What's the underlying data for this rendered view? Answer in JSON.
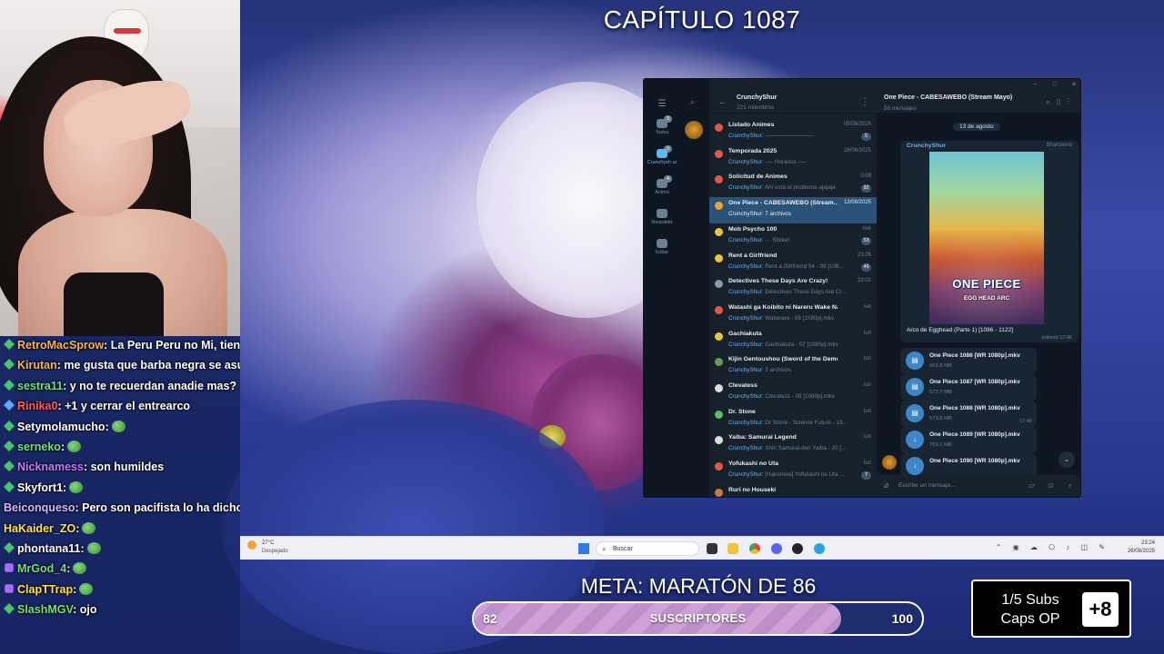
{
  "stream": {
    "title": "CAPÍTULO 1087",
    "goal_title": "META: MARATÓN DE 86",
    "goal": {
      "current": "82",
      "label": "SUSCRIPTORES",
      "max": "100",
      "progress_fraction": 0.82
    },
    "subs_box": {
      "line1": "1/5 Subs",
      "line2": "Caps OP",
      "plus": "+8"
    }
  },
  "chat": [
    {
      "badge": "diamond",
      "user": "RetroMacSprow",
      "color": "#ffb347",
      "msg": ": La Peru Peru no Mi, tiene"
    },
    {
      "badge": "diamond",
      "user": "Kirutan",
      "color": "#ffb347",
      "msg": ": me gusta que barba negra se asu"
    },
    {
      "badge": "diamond",
      "user": "sestra11",
      "color": "#6fe37a",
      "msg": ": y no te recuerdan anadie mas?"
    },
    {
      "badge": "blue",
      "user": "Rinika0",
      "color": "#ff5a5a",
      "msg": ": +1 y cerrar el entrearco"
    },
    {
      "badge": "diamond",
      "user": "Setymolamucho",
      "color": "#ffffff",
      "msg": ":",
      "emote": true
    },
    {
      "badge": "diamond",
      "user": "serneko",
      "color": "#6fe37a",
      "msg": ":",
      "emote": true
    },
    {
      "badge": "diamond",
      "user": "Nicknamess",
      "color": "#c778ff",
      "msg": ": son humildes"
    },
    {
      "badge": "diamond",
      "user": "Skyfort1",
      "color": "#ffffff",
      "msg": ":",
      "emote": true
    },
    {
      "badge": "",
      "user": "Beiconqueso",
      "color": "#d7b6ff",
      "msg": ": Pero son pacifista lo ha dicho"
    },
    {
      "badge": "",
      "user": "HaKaider_ZO",
      "color": "#ffe14a",
      "msg": ":",
      "emote": true
    },
    {
      "badge": "diamond",
      "user": "phontana11",
      "color": "#ffffff",
      "msg": ":",
      "emote": true
    },
    {
      "badge": "purple",
      "user": "MrGod_4",
      "color": "#6fe37a",
      "msg": ":",
      "emote": true
    },
    {
      "badge": "purple",
      "user": "ClapTTrap",
      "color": "#ffe14a",
      "msg": ":",
      "emote": true
    },
    {
      "badge": "diamond",
      "user": "SlashMGV",
      "color": "#6fe37a",
      "msg": ": ojo"
    }
  ],
  "telegram": {
    "group_name": "CrunchyShur",
    "group_members": "221 miembros",
    "rail": [
      {
        "label": "Todos",
        "count": "3"
      },
      {
        "label": "Crunchysh ur",
        "count": "3"
      },
      {
        "label": "Animú",
        "count": "4"
      },
      {
        "label": "Respaldo",
        "count": ""
      },
      {
        "label": "Editar",
        "count": ""
      }
    ],
    "chats": [
      {
        "title": "Listado Animes",
        "date": "05/08/2025",
        "preview_user": "CrunchyShur:",
        "preview": " ────────────",
        "count": "5",
        "icon": "#e2574c"
      },
      {
        "title": "Temporada 2025",
        "date": "28/06/2025",
        "preview_user": "CrunchyShur:",
        "preview": " ── Horarios ──",
        "count": "",
        "icon": "#e2574c"
      },
      {
        "title": "Solicitud de Animes",
        "date": "0:09",
        "preview_user": "CrunchyShur:",
        "preview": " Ahí está el problema ajajaja",
        "count": "92",
        "icon": "#e2574c"
      },
      {
        "title": "One Piece - CABESAWEBO (Stream...",
        "date": "13/08/2025",
        "preview_user": "CrunchyShur:",
        "preview": " 7 archivos",
        "count": "",
        "icon": "#e8a838",
        "selected": true
      },
      {
        "title": "Mob Psycho 100",
        "date": "mié",
        "preview_user": "CrunchyShur:",
        "preview": " ··· Sticker",
        "count": "53",
        "icon": "#e8c838"
      },
      {
        "title": "Rent a Girlfriend",
        "date": "23:05",
        "preview_user": "CrunchyShur:",
        "preview": " Rent a Girlfriend 54 - 09 [108...",
        "count": "49",
        "icon": "#e8c838"
      },
      {
        "title": "Detectives These Days Are Crazy!",
        "date": "23:01",
        "preview_user": "CrunchyShur:",
        "preview": " Detectives These Days Are Cr...",
        "count": "",
        "icon": "#8899aa"
      },
      {
        "title": "Watashi ga Koibito ni Nareru Wake Nai J...",
        "date": "lun",
        "preview_user": "CrunchyShur:",
        "preview": " Watanare - 08 [1080p].mkv",
        "count": "",
        "icon": "#e2574c"
      },
      {
        "title": "Gachiakuta",
        "date": "lun",
        "preview_user": "CrunchyShur:",
        "preview": " Gachiakuta - 07 [1080p].mkv",
        "count": "",
        "icon": "#e8c838"
      },
      {
        "title": "Kijin Gentoushou (Sword of the Demon H...",
        "date": "lun",
        "preview_user": "CrunchyShur:",
        "preview": " 2 archivos",
        "count": "",
        "icon": "#6c9a5a"
      },
      {
        "title": "Clevatess",
        "date": "lun",
        "preview_user": "CrunchyShur:",
        "preview": " Clevatess - 08 [1080p].mkv",
        "count": "",
        "icon": "#dddddd"
      },
      {
        "title": "Dr. Stone",
        "date": "lun",
        "preview_user": "CrunchyShur:",
        "preview": " Dr Stone - Science Future - 19...",
        "count": "",
        "icon": "#5fbf5f"
      },
      {
        "title": "Yaiba: Samurai Legend",
        "date": "lun",
        "preview_user": "CrunchyShur:",
        "preview": " Shin Samurai-den Yaiba - 20 [...",
        "count": "",
        "icon": "#dddddd"
      },
      {
        "title": "Yofukashi no Uta",
        "date": "lun",
        "preview_user": "CrunchyShur:",
        "preview": " [Hakoniwa] Yofukashi no Uta ...",
        "count": "7",
        "icon": "#e2574c"
      },
      {
        "title": "Ruri no Houseki",
        "date": "",
        "preview_user": "",
        "preview": "",
        "count": "",
        "icon": "#c87a4a"
      }
    ],
    "conversation": {
      "title": "One Piece - CABESAWEBO (Stream Mayo)",
      "subtitle": "56 mensajes",
      "date_pill": "13 de agosto",
      "post_author": "CrunchyShur",
      "post_role": "Shurciervo",
      "cover_logo": "ONE PIECE",
      "cover_arc": "EGG HEAD ARC",
      "caption": "Arco de Egghead (Parte 1) [1086 - 1122]",
      "edited": "editado 17:46",
      "files": [
        {
          "name": "One Piece 1086 [WR 1080p].mkv",
          "size": "652.8 MB",
          "time": "",
          "icon": "file"
        },
        {
          "name": "One Piece 1087 [WR 1080p].mkv",
          "size": "573.7 MB",
          "time": "",
          "icon": "file"
        },
        {
          "name": "One Piece 1088 [WR 1080p].mkv",
          "size": "573.8 MB",
          "time": "17:46",
          "icon": "file"
        },
        {
          "name": "One Piece 1089 [WR 1080p].mkv",
          "size": "763.1 MB",
          "time": "",
          "icon": "download"
        },
        {
          "name": "One Piece 1090 [WR 1080p].mkv",
          "size": "",
          "time": "",
          "icon": "download"
        }
      ],
      "compose_placeholder": "Escribe un mensaje..."
    }
  },
  "taskbar": {
    "weather_temp": "27°C",
    "weather_desc": "Despejado",
    "search_placeholder": "Buscar",
    "time": "23:24",
    "date": "26/08/2025"
  }
}
